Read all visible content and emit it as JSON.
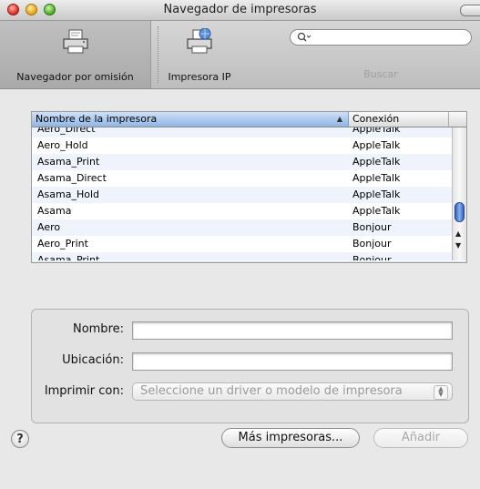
{
  "window": {
    "title": "Navegador de impresoras"
  },
  "toolbar": {
    "items": [
      {
        "label": "Navegador por omisión",
        "icon": "printer-icon",
        "selected": true
      },
      {
        "label": "Impresora IP",
        "icon": "ip-printer-icon",
        "selected": false
      }
    ],
    "search": {
      "value": "",
      "placeholder": "",
      "caption": "Buscar"
    }
  },
  "printer_table": {
    "columns": [
      "Nombre de la impresora",
      "Conexión"
    ],
    "sort_column": "Nombre de la impresora",
    "rows": [
      {
        "name": "Aero_Direct",
        "connection": "AppleTalk"
      },
      {
        "name": "Aero_Hold",
        "connection": "AppleTalk"
      },
      {
        "name": "Asama_Print",
        "connection": "AppleTalk"
      },
      {
        "name": "Asama_Direct",
        "connection": "AppleTalk"
      },
      {
        "name": "Asama_Hold",
        "connection": "AppleTalk"
      },
      {
        "name": "Asama",
        "connection": "AppleTalk"
      },
      {
        "name": "Aero",
        "connection": "Bonjour"
      },
      {
        "name": "Aero_Print",
        "connection": "Bonjour"
      },
      {
        "name": "Asama_Print",
        "connection": "Bonjour"
      }
    ]
  },
  "form": {
    "name_label": "Nombre:",
    "name_value": "",
    "location_label": "Ubicación:",
    "location_value": "",
    "print_with_label": "Imprimir con:",
    "print_with_value": "Seleccione un driver o modelo de impresora"
  },
  "buttons": {
    "help": "?",
    "more_printers": "Más impresoras...",
    "add": "Añadir"
  },
  "colors": {
    "selected_header": "#8fb5e6",
    "scroll_thumb": "#2d5fbf",
    "disabled_text": "#a8a8a8"
  }
}
